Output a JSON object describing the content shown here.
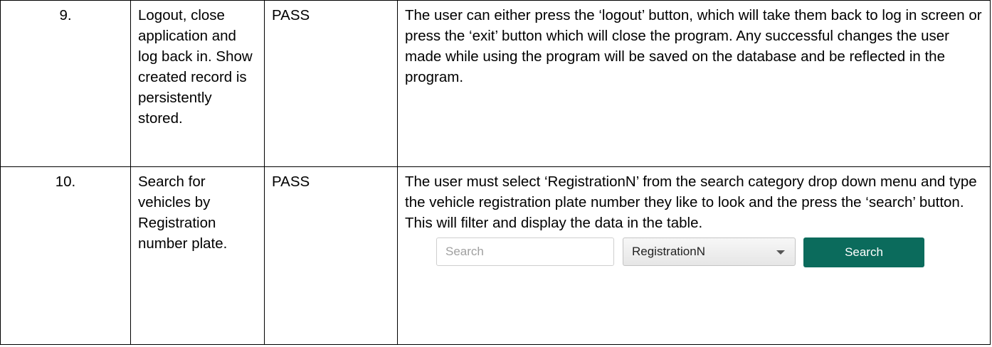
{
  "rows": [
    {
      "number": "9.",
      "test": "Logout, close application and log back in. Show created record is persistently stored.",
      "result": "PASS",
      "notes": "The user can either press the ‘logout’ button, which will take them back to log in screen or press the ‘exit’ button which will close the program. Any successful changes the user made while using the program will be saved on the database and be reflected in the program."
    },
    {
      "number": "10.",
      "test": "Search for vehicles by Registration number plate.",
      "result": "PASS",
      "notes": "The user must select ‘RegistrationN’ from the search category drop down menu and type the vehicle registration plate number they like to look and the press the ‘search’ button. This will filter and display the data in the table."
    }
  ],
  "search_widget": {
    "input_placeholder": "Search",
    "input_value": "",
    "category_selected": "RegistrationN",
    "button_label": "Search",
    "button_color": "#0b6b5c"
  }
}
